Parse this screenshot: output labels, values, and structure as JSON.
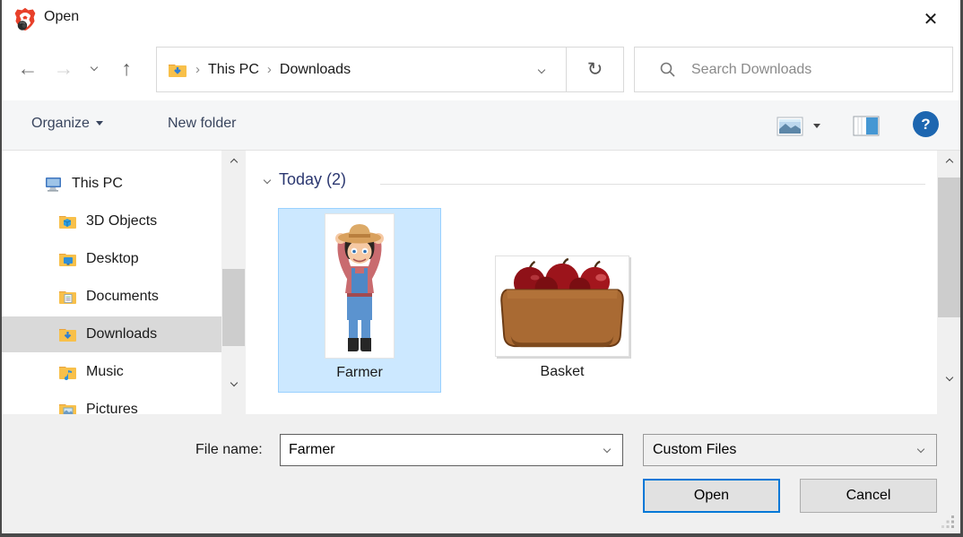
{
  "window": {
    "title": "Open",
    "close_glyph": "✕"
  },
  "nav": {
    "breadcrumb": {
      "sep": "›",
      "items": [
        {
          "label": "This PC"
        },
        {
          "label": "Downloads"
        }
      ]
    },
    "search_placeholder": "Search Downloads"
  },
  "toolbar": {
    "organize_label": "Organize",
    "new_folder_label": "New folder",
    "help_glyph": "?"
  },
  "sidebar": {
    "items": [
      {
        "label": "This PC",
        "icon": "pc",
        "selected": false
      },
      {
        "label": "3D Objects",
        "icon": "folder-3d",
        "selected": false
      },
      {
        "label": "Desktop",
        "icon": "folder-desktop",
        "selected": false
      },
      {
        "label": "Documents",
        "icon": "folder-documents",
        "selected": false
      },
      {
        "label": "Downloads",
        "icon": "folder-downloads",
        "selected": true
      },
      {
        "label": "Music",
        "icon": "folder-music",
        "selected": false
      },
      {
        "label": "Pictures",
        "icon": "folder-pictures",
        "selected": false
      }
    ]
  },
  "content": {
    "group_label": "Today (2)",
    "files": [
      {
        "name": "Farmer",
        "selected": true
      },
      {
        "name": "Basket",
        "selected": false
      }
    ]
  },
  "footer": {
    "file_name_label": "File name:",
    "file_name_value": "Farmer",
    "file_type_value": "Custom Files",
    "open_label": "Open",
    "cancel_label": "Cancel"
  },
  "glyphs": {
    "back": "←",
    "forward": "→",
    "up": "↑",
    "refresh": "↻"
  },
  "colors": {
    "accent_blue": "#0078d7",
    "selection_fill": "#cce8ff",
    "selection_border": "#99d1ff",
    "group_header_navy": "#2b3770",
    "help_blue": "#1d66b0",
    "sidebar_selected": "#d9d9d9"
  }
}
